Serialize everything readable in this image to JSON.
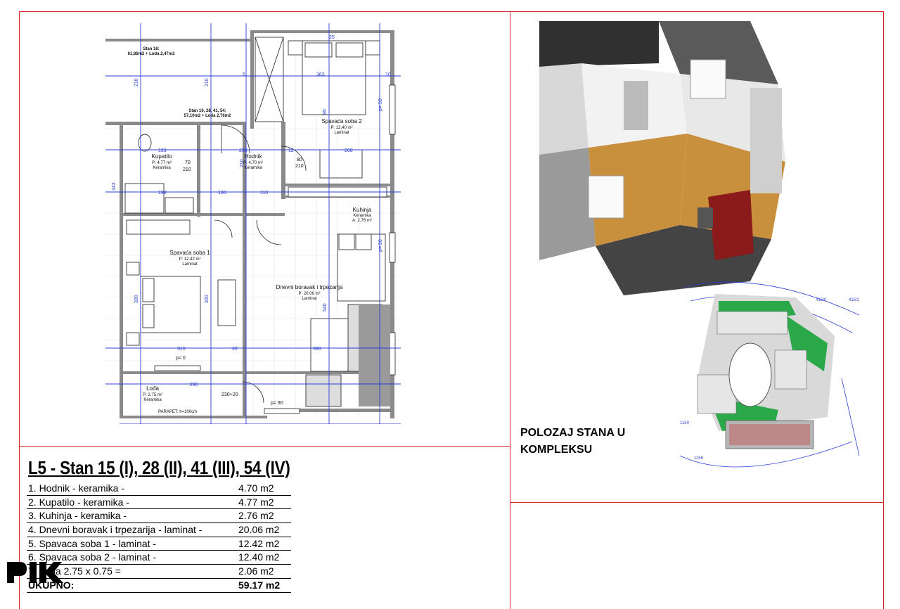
{
  "plan": {
    "rooms": [
      {
        "name": "Stan 16:",
        "area": "61,86m2 + Loda 2,47m2"
      },
      {
        "name": "Stan 16, 28, 41, 54:",
        "area": "57,10m2 + Loda 2,76m2"
      },
      {
        "name": "Spavaća soba 2",
        "area": "P: 12.40 m²",
        "floor": "Laminat"
      },
      {
        "name": "Kupatilo",
        "area": "P: 4.77 m²",
        "floor": "Keramika"
      },
      {
        "name": "Hodnik",
        "area": "P: 4.70 m²",
        "floor": "Keramika"
      },
      {
        "name": "Kuhinja",
        "area": "A: 2.76 m²",
        "floor": "Keramika"
      },
      {
        "name": "Spavaća soba 1",
        "area": "P: 12.42 m²",
        "floor": "Laminat"
      },
      {
        "name": "Dnevni boravak i trpezarija",
        "area": "P: 20.06 m²",
        "floor": "Laminat"
      },
      {
        "name": "Lođa",
        "area": "P: 2.75 m²",
        "floor": "Keramika"
      }
    ],
    "dimensions": {
      "d363": "363",
      "d268": "268",
      "d193": "193",
      "d198": "198",
      "d236": "236",
      "d100": "100",
      "d110": "110",
      "d310": "310",
      "d390": "390",
      "d290": "290",
      "d12": "12",
      "d20": "20",
      "d10": "10",
      "d5": "5",
      "d25": "25",
      "d70": "70",
      "d80": "80",
      "d210": "210",
      "d90": "90",
      "d300": "300",
      "d343": "343",
      "d540": "540",
      "d95": "95",
      "d14": "14",
      "d18": "18",
      "p0": "p= 0",
      "p90": "p= 90",
      "p50": "p= 50",
      "d230": "230+20",
      "parapet": "PARAPET: h=100cm"
    }
  },
  "site": {
    "caption_line1": "POLOZAJ STANA U",
    "caption_line2": "KOMPLEKSU",
    "labels": [
      "415/0",
      "415/2",
      "1150",
      "1156"
    ]
  },
  "title": "L5 - Stan 15 (I), 28 (II), 41 (III), 54 (IV)",
  "rooms_list": [
    {
      "label": "1. Hodnik - keramika -",
      "area": "4.70 m2"
    },
    {
      "label": "2. Kupatilo - keramika -",
      "area": "4.77 m2"
    },
    {
      "label": "3. Kuhinja - keramika -",
      "area": "2.76 m2"
    },
    {
      "label": "4. Dnevni boravak i trpezarija - laminat -",
      "area": "20.06 m2"
    },
    {
      "label": "5. Spavaca soba 1 - laminat -",
      "area": "12.42 m2"
    },
    {
      "label": "6. Spavaca soba 2 - laminat -",
      "area": "12.40 m2"
    },
    {
      "label": "7. Loda 2.75 x 0.75 =",
      "area": "2.06 m2"
    }
  ],
  "total": {
    "label": "UKUPNO:",
    "area": "59.17 m2"
  },
  "colors": {
    "frame": "#d8262c",
    "dimension": "#2b3fd6",
    "wall": "#7a7a7a"
  }
}
